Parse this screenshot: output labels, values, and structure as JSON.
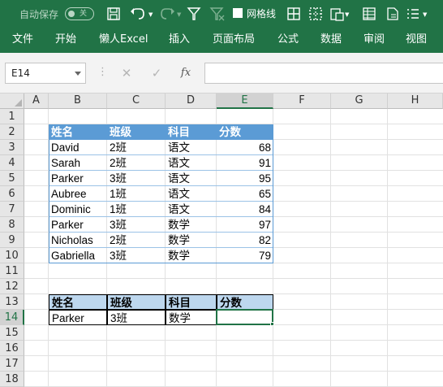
{
  "titlebar": {
    "autosave_label": "自动保存",
    "autosave_state": "关",
    "gridlines_label": "网格线",
    "gridlines_checked": true
  },
  "tabs": [
    "文件",
    "开始",
    "懒人Excel",
    "插入",
    "页面布局",
    "公式",
    "数据",
    "审阅",
    "视图"
  ],
  "formula_bar": {
    "name_box": "E14",
    "cancel_glyph": "✕",
    "enter_glyph": "✓",
    "fx_label": "fx",
    "value": ""
  },
  "columns": [
    "A",
    "B",
    "C",
    "D",
    "E",
    "F",
    "G",
    "H"
  ],
  "rows": [
    "1",
    "2",
    "3",
    "4",
    "5",
    "6",
    "7",
    "8",
    "9",
    "10",
    "11",
    "12",
    "13",
    "14",
    "15",
    "16",
    "17",
    "18"
  ],
  "selected": {
    "col": "E",
    "row": "14"
  },
  "table1": {
    "headers": [
      "姓名",
      "班级",
      "科目",
      "分数"
    ],
    "rows": [
      [
        "David",
        "2班",
        "语文",
        "68"
      ],
      [
        "Sarah",
        "2班",
        "语文",
        "91"
      ],
      [
        "Parker",
        "3班",
        "语文",
        "95"
      ],
      [
        "Aubree",
        "1班",
        "语文",
        "65"
      ],
      [
        "Dominic",
        "1班",
        "语文",
        "84"
      ],
      [
        "Parker",
        "3班",
        "数学",
        "97"
      ],
      [
        "Nicholas",
        "2班",
        "数学",
        "82"
      ],
      [
        "Gabriella",
        "3班",
        "数学",
        "79"
      ]
    ]
  },
  "table2": {
    "headers": [
      "姓名",
      "班级",
      "科目",
      "分数"
    ],
    "row": [
      "Parker",
      "3班",
      "数学",
      ""
    ]
  },
  "colors": {
    "ribbon": "#217346",
    "table_header": "#5b9bd5",
    "lookup_header": "#bdd7ee"
  }
}
